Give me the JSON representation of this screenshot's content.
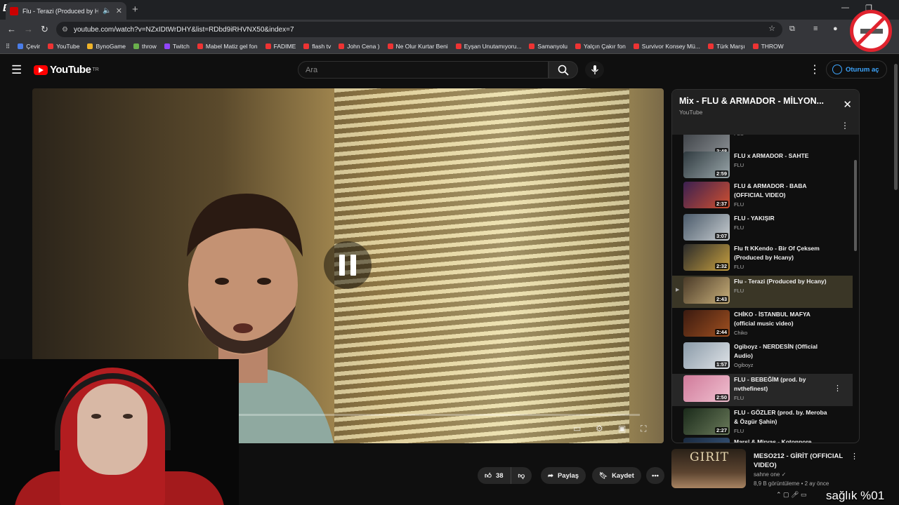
{
  "browser": {
    "tab_title": "Flu - Terazi (Produced by H",
    "url": "youtube.com/watch?v=NZxIDtWrDHY&list=RDbd9iRHVNX50&index=7",
    "bookmarks": [
      {
        "label": "Çevir",
        "color": "b"
      },
      {
        "label": "YouTube",
        "color": ""
      },
      {
        "label": "BynoGame",
        "color": "y"
      },
      {
        "label": "throw",
        "color": "g"
      },
      {
        "label": "Twitch",
        "color": "p"
      },
      {
        "label": "Mabel Matiz gel fon",
        "color": ""
      },
      {
        "label": "FADIME",
        "color": ""
      },
      {
        "label": "flash tv",
        "color": ""
      },
      {
        "label": "John Cena )",
        "color": ""
      },
      {
        "label": "Ne Olur Kurtar Beni",
        "color": ""
      },
      {
        "label": "Eyşan Unutamıyoru...",
        "color": ""
      },
      {
        "label": "Samanyolu",
        "color": ""
      },
      {
        "label": "Yalçın Çakır fon",
        "color": ""
      },
      {
        "label": "Survivor Konsey Mü...",
        "color": ""
      },
      {
        "label": "Türk Marşı",
        "color": ""
      },
      {
        "label": "THROW",
        "color": ""
      }
    ]
  },
  "youtube": {
    "logo_text": "YouTube",
    "country": "TR",
    "search_placeholder": "Ara",
    "signin_label": "Oturum aç",
    "actions": {
      "likes": "38",
      "share": "Paylaş",
      "save": "Kaydet"
    }
  },
  "playlist": {
    "title": "Mix - FLU & ARMADOR - MİLYON...",
    "subtitle": "YouTube",
    "items": [
      {
        "title": "",
        "channel": "FLU",
        "duration": "2:48",
        "c1": "#3b3f44",
        "c2": "#8a8f93",
        "state": ""
      },
      {
        "title": "FLU x ARMADOR - SAHTE",
        "channel": "FLU",
        "duration": "2:59",
        "c1": "#2f3a3f",
        "c2": "#9aa6aa",
        "state": ""
      },
      {
        "title": "FLU & ARMADOR - BABA (OFFICIAL VIDEO)",
        "channel": "FLU",
        "duration": "2:37",
        "c1": "#3a2050",
        "c2": "#d05030",
        "state": ""
      },
      {
        "title": "FLU - YAKIŞIR",
        "channel": "FLU",
        "duration": "3:07",
        "c1": "#4a5a6a",
        "c2": "#c8cdd0",
        "state": ""
      },
      {
        "title": "Flu ft KKendo - Bir Of Çeksem (Produced by Hcany)",
        "channel": "FLU",
        "duration": "2:32",
        "c1": "#2a2a2a",
        "c2": "#c7a040",
        "state": ""
      },
      {
        "title": "Flu - Terazi (Produced by Hcany)",
        "channel": "FLU",
        "duration": "2:43",
        "c1": "#4a3a28",
        "c2": "#c9b07a",
        "state": "active"
      },
      {
        "title": "CHİKO - İSTANBUL MAFYA (official music video)",
        "channel": "Chiko",
        "duration": "2:44",
        "c1": "#3a1a10",
        "c2": "#a05020",
        "state": ""
      },
      {
        "title": "Ogiboyz - NERDESİN (Official Audio)",
        "channel": "Ogiboyz",
        "duration": "1:57",
        "c1": "#8a9aa8",
        "c2": "#e0e4e8",
        "state": ""
      },
      {
        "title": "FLU - BEBEĞİM (prod. by nvthefinest)",
        "channel": "FLU",
        "duration": "2:50",
        "c1": "#d07a9a",
        "c2": "#f0c0d0",
        "state": "hover"
      },
      {
        "title": "FLU - GÖZLER (prod. by. Meroba & Özgür Şahin)",
        "channel": "FLU",
        "duration": "2:27",
        "c1": "#1a2a1a",
        "c2": "#6a7a5a",
        "state": ""
      },
      {
        "title": "Marsî & Mirvas - Kotonnore",
        "channel": "",
        "duration": "",
        "c1": "#1a2a40",
        "c2": "#3a5a80",
        "state": ""
      }
    ]
  },
  "recommendation": {
    "thumb_text": "GIRIT",
    "title": "MESO212 - GİRİT (OFFICIAL VIDEO)",
    "channel": "sahne one",
    "meta": "8,9 B görüntüleme • 2 ay önce"
  },
  "overlay": {
    "text": "sağlık %01",
    "brand": "B"
  }
}
